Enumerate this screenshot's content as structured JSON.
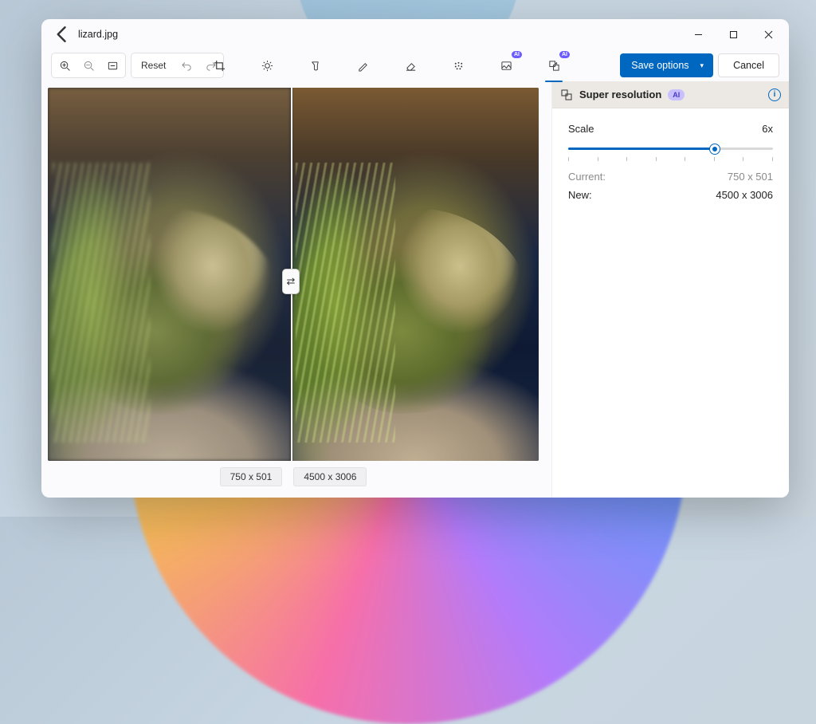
{
  "title": "lizard.jpg",
  "toolbar": {
    "reset": "Reset",
    "save": "Save options",
    "cancel": "Cancel",
    "ai_badge": "AI"
  },
  "canvas": {
    "left_dims": "750 x 501",
    "right_dims": "4500 x 3006"
  },
  "panel": {
    "title": "Super resolution",
    "ai_badge": "AI",
    "scale_label": "Scale",
    "scale_value": "6x",
    "scale_min": 1,
    "scale_max": 8,
    "scale_current": 6,
    "current_label": "Current:",
    "current_value": "750 x 501",
    "new_label": "New:",
    "new_value": "4500 x 3006"
  },
  "colors": {
    "accent": "#0067c0"
  }
}
